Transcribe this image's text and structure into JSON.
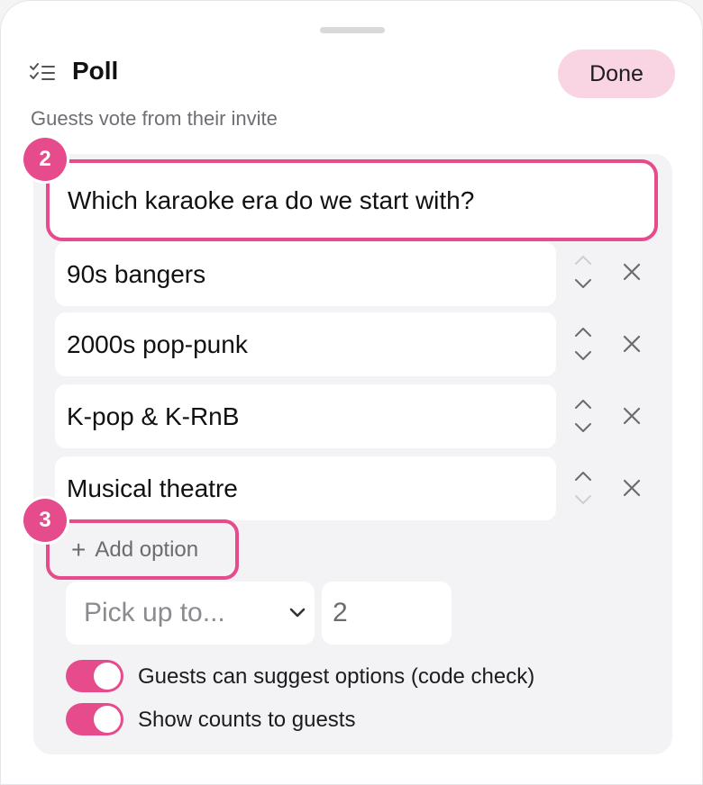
{
  "header": {
    "title": "Poll",
    "done_label": "Done",
    "subtitle": "Guests vote from their invite"
  },
  "badges": [
    "2",
    "3"
  ],
  "question": {
    "value": "Which karaoke era do we start with?"
  },
  "options": [
    {
      "label": "90s bangers",
      "up_enabled": false,
      "down_enabled": true
    },
    {
      "label": "2000s pop-punk",
      "up_enabled": true,
      "down_enabled": true
    },
    {
      "label": "K-pop & K-RnB",
      "up_enabled": true,
      "down_enabled": true
    },
    {
      "label": "Musical theatre",
      "up_enabled": true,
      "down_enabled": false
    }
  ],
  "add_option_label": "Add option",
  "pick_select": {
    "placeholder": "Pick up to...",
    "options": [
      "Pick up to..."
    ]
  },
  "pick_count": {
    "value": "2"
  },
  "settings": [
    {
      "label": "Guests can suggest options (code check)",
      "on": true
    },
    {
      "label": "Show counts to guests",
      "on": true
    }
  ],
  "icons": {
    "header": "checklist-icon",
    "reorder": "reorder-arrows-icon",
    "remove": "close-icon",
    "add": "plus-icon",
    "select": "chevron-down-icon"
  },
  "colors": {
    "accent": "#e64b8c",
    "done_bg": "#f9d4e3",
    "panel_bg": "#f3f3f5"
  }
}
